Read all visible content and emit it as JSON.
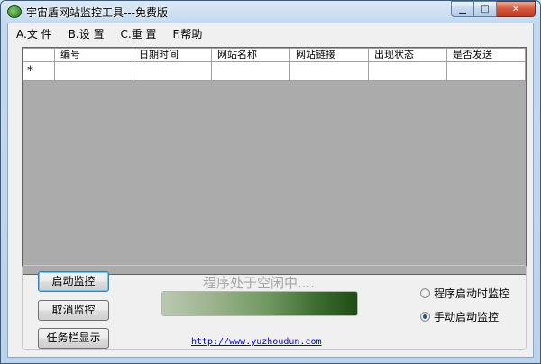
{
  "window": {
    "title": "宇宙盾网站监控工具---免费版",
    "icon": "shield-globe-icon",
    "controls": {
      "minimize": "minimize-icon",
      "maximize": "maximize-icon",
      "close": "close-icon"
    }
  },
  "menu": [
    {
      "label": "A.文 件"
    },
    {
      "label": "B.设 置"
    },
    {
      "label": "C.重 置"
    },
    {
      "label": "F.帮助"
    }
  ],
  "grid": {
    "columns": [
      "编号",
      "日期时间",
      "网站名称",
      "网站链接",
      "出现状态",
      "是否发送"
    ],
    "new_row_marker": "*"
  },
  "buttons": {
    "start": "启动监控",
    "cancel": "取消监控",
    "tray": "任务栏显示"
  },
  "status": {
    "text": "程序处于空闲中....",
    "progress": 1.0
  },
  "link": "http://www.yuzhoudun.com",
  "options": {
    "auto": {
      "label": "程序启动时监控",
      "checked": false
    },
    "manual": {
      "label": "手动启动监控",
      "checked": true
    }
  },
  "colors": {
    "progress_dark": "#1f4d15",
    "link": "#0000ee",
    "close_button": "#c23a1f"
  }
}
